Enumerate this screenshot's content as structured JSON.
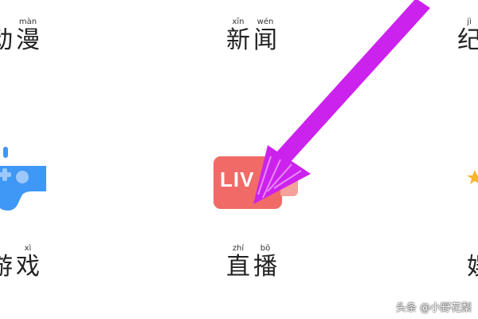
{
  "categories": {
    "top": [
      {
        "id": "anim",
        "chars": [
          {
            "pinyin": "",
            "hanzi": "动"
          },
          {
            "pinyin": "màn",
            "hanzi": "漫"
          }
        ]
      },
      {
        "id": "news",
        "chars": [
          {
            "pinyin": "xīn",
            "hanzi": "新"
          },
          {
            "pinyin": "wén",
            "hanzi": "闻"
          }
        ]
      },
      {
        "id": "doc",
        "chars": [
          {
            "pinyin": "jì",
            "hanzi": "纪"
          }
        ]
      }
    ],
    "bottom": [
      {
        "id": "game",
        "chars": [
          {
            "pinyin": "",
            "hanzi": "游"
          },
          {
            "pinyin": "xì",
            "hanzi": "戏"
          }
        ]
      },
      {
        "id": "live",
        "chars": [
          {
            "pinyin": "zhí",
            "hanzi": "直"
          },
          {
            "pinyin": "bō",
            "hanzi": "播"
          }
        ]
      },
      {
        "id": "right2",
        "chars": [
          {
            "pinyin": "",
            "hanzi": "娱"
          }
        ]
      }
    ]
  },
  "live_icon": {
    "text": "LIV"
  },
  "icons": {
    "gamepad": "gamepad-icon",
    "live": "live-icon",
    "right_partial": "star-icon",
    "arrow": "arrow-annotation-icon"
  },
  "colors": {
    "gamepad": "#3f97f6",
    "live_red": "#f06b67",
    "live_tab": "#f5a09a",
    "arrow": "#cc22ee",
    "star": "#f8b62d"
  },
  "watermark": "头条 @小野花梨"
}
